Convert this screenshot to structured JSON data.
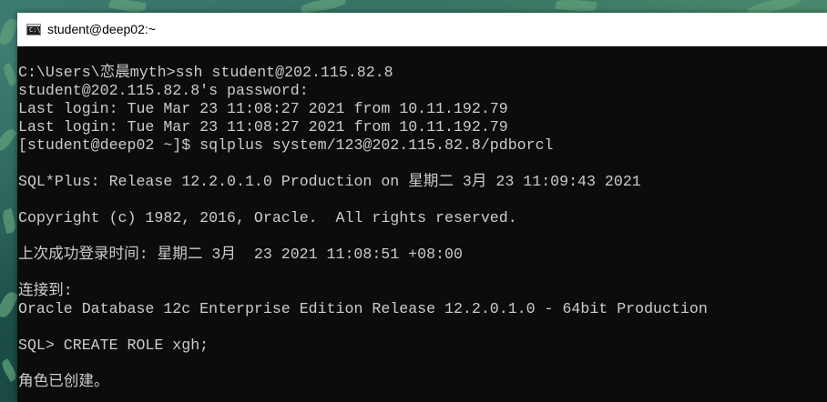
{
  "window": {
    "title": "student@deep02:~",
    "icon": "cmd-icon",
    "icon_text": "C:\\"
  },
  "console": {
    "lines": [
      "C:\\Users\\恋晨myth>ssh student@202.115.82.8",
      "student@202.115.82.8's password:",
      "Last login: Tue Mar 23 11:08:27 2021 from 10.11.192.79",
      "Last login: Tue Mar 23 11:08:27 2021 from 10.11.192.79",
      "[student@deep02 ~]$ sqlplus system/123@202.115.82.8/pdborcl",
      "",
      "SQL*Plus: Release 12.2.0.1.0 Production on 星期二 3月 23 11:09:43 2021",
      "",
      "Copyright (c) 1982, 2016, Oracle.  All rights reserved.",
      "",
      "上次成功登录时间: 星期二 3月  23 2021 11:08:51 +08:00",
      "",
      "连接到:",
      "Oracle Database 12c Enterprise Edition Release 12.2.0.1.0 - 64bit Production",
      "",
      "SQL> CREATE ROLE xgh;",
      "",
      "角色已创建。"
    ]
  },
  "colors": {
    "console_bg": "#0c0c0c",
    "console_fg": "#cccccc",
    "titlebar_bg": "#ffffff"
  }
}
